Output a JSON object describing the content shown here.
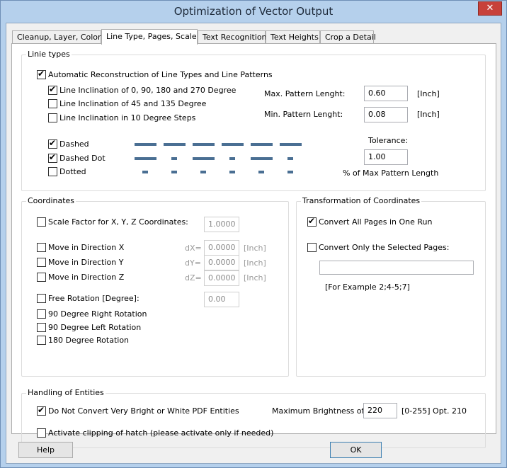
{
  "window": {
    "title": "Optimization of Vector Output",
    "close_glyph": "✕"
  },
  "tabs": [
    {
      "label": "Cleanup, Layer, Colors"
    },
    {
      "label": "Line Type, Pages, Scale"
    },
    {
      "label": "Text Recognition"
    },
    {
      "label": "Text Heights"
    },
    {
      "label": "Crop a Detail"
    }
  ],
  "active_tab": "Line Type, Pages, Scale",
  "line_types": {
    "group_label": "Linie types",
    "auto_reconstruct": {
      "label": "Automatic Reconstruction of Line Types and Line Patterns",
      "checked": true
    },
    "inclinations": [
      {
        "label": "Line Inclination of 0, 90, 180 and 270 Degree",
        "checked": true
      },
      {
        "label": "Line Inclination of 45 and 135 Degree",
        "checked": false
      },
      {
        "label": "Line Inclination in 10 Degree Steps",
        "checked": false
      }
    ],
    "max_pattern": {
      "label": "Max. Pattern Lenght:",
      "value": "0.60",
      "unit": "[Inch]"
    },
    "min_pattern": {
      "label": "Min. Pattern Lenght:",
      "value": "0.08",
      "unit": "[Inch]"
    },
    "patterns": [
      {
        "label": "Dashed",
        "checked": true
      },
      {
        "label": "Dashed Dot",
        "checked": true
      },
      {
        "label": "Dotted",
        "checked": false
      }
    ],
    "tolerance": {
      "label": "Tolerance:",
      "value": "1.00",
      "caption": "% of Max Pattern Length"
    }
  },
  "coordinates": {
    "group_label": "Coordinates",
    "scale_factor": {
      "label": "Scale Factor for X, Y, Z Coordinates:",
      "value": "1.0000",
      "checked": false
    },
    "moves": [
      {
        "label": "Move in Direction X",
        "prefix": "dX=",
        "value": "0.0000",
        "unit": "[Inch]",
        "checked": false
      },
      {
        "label": "Move in Direction Y",
        "prefix": "dY=",
        "value": "0.0000",
        "unit": "[Inch]",
        "checked": false
      },
      {
        "label": "Move in Direction Z",
        "prefix": "dZ=",
        "value": "0.0000",
        "unit": "[Inch]",
        "checked": false
      }
    ],
    "free_rotation": {
      "label": "Free Rotation [Degree]:",
      "value": "0.00",
      "checked": false
    },
    "rotations": [
      {
        "label": "90 Degree Right Rotation",
        "checked": false
      },
      {
        "label": "90 Degree Left Rotation",
        "checked": false
      },
      {
        "label": "180 Degree Rotation",
        "checked": false
      }
    ]
  },
  "transformation": {
    "group_label": "Transformation of Coordinates",
    "all_pages": {
      "label": "Convert All Pages in One Run",
      "checked": true
    },
    "selected_pages": {
      "label": "Convert Only the Selected Pages:",
      "checked": false
    },
    "pages_value": "",
    "example": "[For Example 2;4-5;7]"
  },
  "entities": {
    "group_label": "Handling of Entities",
    "no_bright": {
      "label": "Do Not Convert Very Bright or White PDF Entities",
      "checked": true
    },
    "clip_hatch": {
      "label": "Activate clipping of hatch (please activate only if needed)",
      "checked": false
    },
    "max_brightness": {
      "label": "Maximum Brightness of",
      "value": "220",
      "range": "[0-255] Opt. 210"
    }
  },
  "buttons": {
    "help": "Help",
    "ok": "OK"
  },
  "colors": {
    "dash": "#4a6f93",
    "title_bar": "#b5d0ec",
    "close": "#c7413a"
  }
}
